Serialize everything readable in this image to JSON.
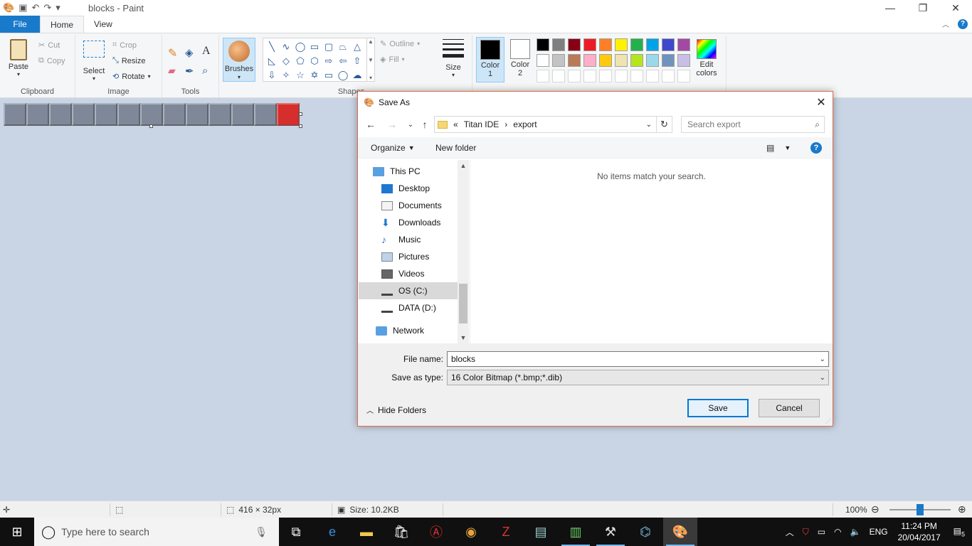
{
  "window": {
    "title": "blocks - Paint"
  },
  "ribbon": {
    "tabs": {
      "file": "File",
      "home": "Home",
      "view": "View"
    },
    "clipboard": {
      "paste": "Paste",
      "cut": "Cut",
      "copy": "Copy",
      "label": "Clipboard"
    },
    "image": {
      "select": "Select",
      "crop": "Crop",
      "resize": "Resize",
      "rotate": "Rotate",
      "label": "Image"
    },
    "tools": {
      "label": "Tools",
      "text_icon": "A"
    },
    "brushes": {
      "label": "Brushes"
    },
    "shapes": {
      "label": "Shapes",
      "outline": "Outline",
      "fill": "Fill"
    },
    "size": {
      "label": "Size"
    },
    "colors": {
      "color1_line1": "Color",
      "color1_line2": "1",
      "color2_line1": "Color",
      "color2_line2": "2",
      "edit_line1": "Edit",
      "edit_line2": "colors",
      "color1_hex": "#000000",
      "color2_hex": "#ffffff",
      "palette_row1": [
        "#000000",
        "#7f7f7f",
        "#880015",
        "#ed1c24",
        "#ff7f27",
        "#fff200",
        "#22b14c",
        "#00a2e8",
        "#3f48cc",
        "#a349a4"
      ],
      "palette_row2": [
        "#ffffff",
        "#c3c3c3",
        "#b97a57",
        "#ffaec9",
        "#ffc90e",
        "#efe4b0",
        "#b5e61d",
        "#99d9ea",
        "#7092be",
        "#c8bfe7"
      ]
    }
  },
  "statusbar": {
    "dimensions": "416 × 32px",
    "size": "Size: 10.2KB",
    "zoom": "100%"
  },
  "dialog": {
    "title": "Save As",
    "breadcrumb": {
      "prefix": "«",
      "part1": "Titan IDE",
      "sep": "›",
      "part2": "export"
    },
    "search_placeholder": "Search export",
    "toolbar": {
      "organize": "Organize",
      "new_folder": "New folder"
    },
    "nav": [
      {
        "label": "This PC"
      },
      {
        "label": "Desktop"
      },
      {
        "label": "Documents"
      },
      {
        "label": "Downloads"
      },
      {
        "label": "Music"
      },
      {
        "label": "Pictures"
      },
      {
        "label": "Videos"
      },
      {
        "label": "OS (C:)"
      },
      {
        "label": "DATA (D:)"
      },
      {
        "label": "Network"
      }
    ],
    "empty_message": "No items match your search.",
    "file_name_label": "File name:",
    "file_name_value": "blocks",
    "save_type_label": "Save as type:",
    "save_type_value": "16 Color Bitmap (*.bmp;*.dib)",
    "hide_folders": "Hide Folders",
    "save_button": "Save",
    "cancel_button": "Cancel"
  },
  "taskbar": {
    "search_placeholder": "Type here to search",
    "language": "ENG",
    "time": "11:24 PM",
    "date": "20/04/2017",
    "notifications": "5"
  }
}
